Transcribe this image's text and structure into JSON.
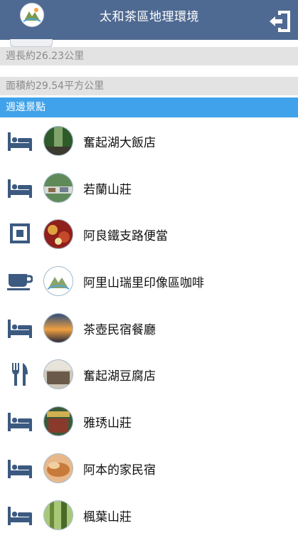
{
  "header": {
    "title": "太和茶區地理環境",
    "logo_icon": "mountain-logo-icon",
    "exit_icon": "exit-door-icon"
  },
  "info": {
    "perimeter": "週長約26.23公里",
    "area": "面積約29.54平方公里"
  },
  "section": {
    "title": "週邊景點"
  },
  "colors": {
    "appbar": "#4f6a92",
    "accent": "#3fa2ea",
    "icon": "#3c5a80"
  },
  "places": [
    {
      "name": "奮起湖大飯店",
      "type": "lodging",
      "icon": "bed-icon",
      "photo": "forest"
    },
    {
      "name": "若蘭山莊",
      "type": "lodging",
      "icon": "bed-icon",
      "photo": "village"
    },
    {
      "name": "阿良鐵支路便當",
      "type": "other",
      "icon": "square-icon",
      "photo": "food"
    },
    {
      "name": "阿里山瑞里印像區咖啡",
      "type": "cafe",
      "icon": "coffee-cup-icon",
      "photo": "logo"
    },
    {
      "name": "茶壺民宿餐廳",
      "type": "lodging",
      "icon": "bed-icon",
      "photo": "sunset"
    },
    {
      "name": "奮起湖豆腐店",
      "type": "restaurant",
      "icon": "fork-knife-icon",
      "photo": "shop"
    },
    {
      "name": "雅琇山莊",
      "type": "lodging",
      "icon": "bed-icon",
      "photo": "storefront"
    },
    {
      "name": "阿本的家民宿",
      "type": "lodging",
      "icon": "bed-icon",
      "photo": "bread"
    },
    {
      "name": "楓葉山莊",
      "type": "lodging",
      "icon": "bed-icon",
      "photo": "trees"
    }
  ]
}
